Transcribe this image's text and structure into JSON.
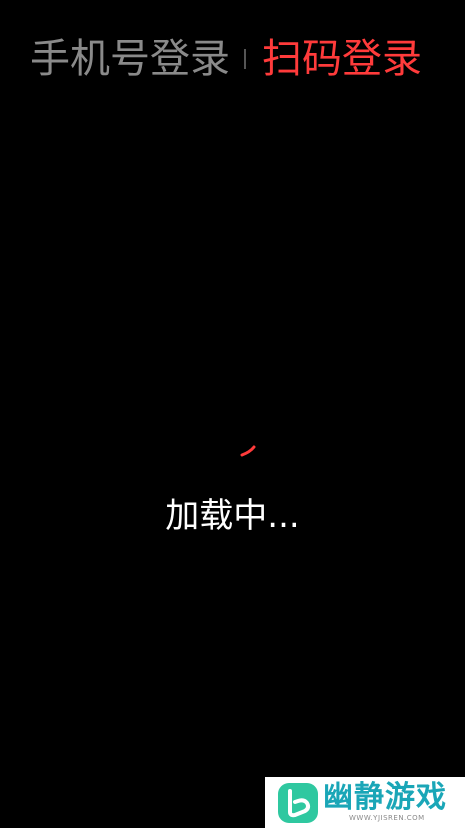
{
  "tabs": {
    "phone_login": "手机号登录",
    "qr_login": "扫码登录"
  },
  "loading": {
    "text": "加载中..."
  },
  "watermark": {
    "name": "幽静游戏",
    "url": "WWW.YJISREN.COM"
  },
  "colors": {
    "background": "#000000",
    "active_tab": "#ff3b3b",
    "inactive_tab": "#8a8a8a",
    "spinner": "#ff3b3b",
    "watermark_brand": "#1aa6b7"
  },
  "icons": {
    "spinner": "loading-spinner-icon",
    "watermark_logo": "yjisren-logo-icon"
  }
}
